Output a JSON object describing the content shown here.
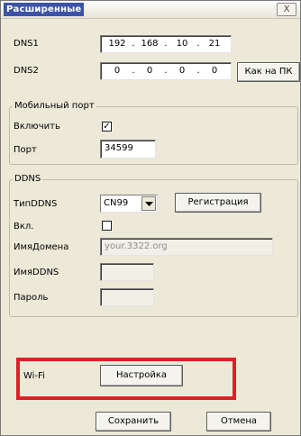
{
  "window": {
    "title": "Расширенные",
    "close_label": "X"
  },
  "dns": {
    "dns1_label": "DNS1",
    "dns1_value": [
      "192",
      "168",
      "10",
      "21"
    ],
    "dns2_label": "DNS2",
    "dns2_value": [
      "0",
      "0",
      "0",
      "0"
    ],
    "as_pc_button": "Как на ПК"
  },
  "mobile_port": {
    "group_title": "Мобильный порт",
    "enable_label": "Включить",
    "enable_checked": true,
    "check_glyph": "✓",
    "port_label": "Порт",
    "port_value": "34599"
  },
  "ddns": {
    "group_title": "DDNS",
    "type_label": "ТипDDNS",
    "type_value": "CN99",
    "register_button": "Регистрация",
    "enabled_label": "Вкл.",
    "enabled_checked": false,
    "domain_label": "ИмяДомена",
    "domain_placeholder": "your.3322.org",
    "ddns_name_label": "ИмяDDNS",
    "ddns_name_value": "",
    "password_label": "Пароль",
    "password_value": ""
  },
  "wifi": {
    "label": "Wi-Fi",
    "settings_button": "Настройка"
  },
  "footer": {
    "save_button": "Сохранить",
    "cancel_button": "Отмена"
  },
  "colors": {
    "highlight": "#e01f26",
    "title_bg": "#3c54a8"
  }
}
